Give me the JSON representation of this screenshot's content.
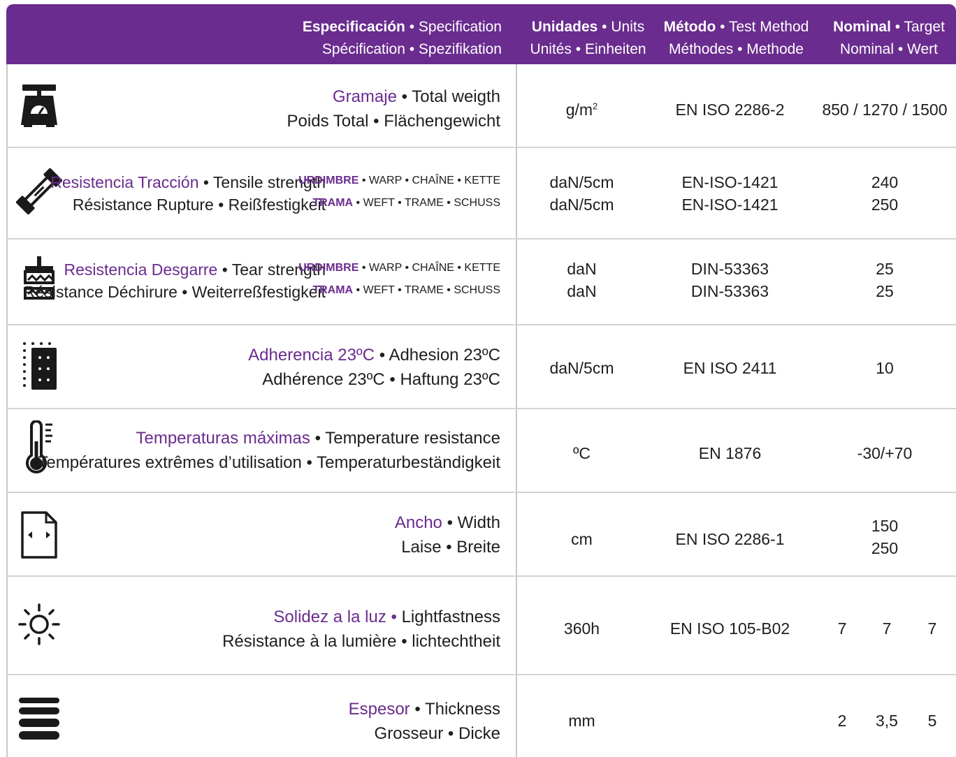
{
  "header": {
    "spec": {
      "bold": "Especificación",
      "rest1": "• Specification",
      "line2": "Spécification • Spezifikation"
    },
    "units": {
      "bold": "Unidades",
      "rest1": "• Units",
      "line2": "Unités • Einheiten"
    },
    "method": {
      "bold": "Método",
      "rest1": "• Test Method",
      "line2": "Méthodes • Methode"
    },
    "nominal": {
      "bold": "Nominal",
      "rest1": "• Target",
      "line2": "Nominal • Wert"
    }
  },
  "icons": {
    "weight": "scale-icon",
    "tensile": "tensile-test-icon",
    "tear": "tear-test-icon",
    "adhesion": "adhesion-icon",
    "temperature": "thermometer-icon",
    "width": "width-icon",
    "light": "sun-icon",
    "thickness": "thickness-icon"
  },
  "rows": {
    "weight": {
      "name": "Gramaje",
      "name_rest": "• Total weigth",
      "line2": "Poids Total • Flächengewicht",
      "units_base": "g/m",
      "units_sup": "2",
      "method": "EN ISO 2286-2",
      "nominal": "850 / 1270 / 1500"
    },
    "tensile": {
      "name": "Resistencia Tracción",
      "name_rest": "• Tensile strength",
      "line2": "Résistance Rupture • Reißfestigkeit",
      "dir1_accent": "URDIMBRE",
      "dir1_rest": "• WARP • CHAÎNE • KETTE",
      "dir2_accent": "TRAMA",
      "dir2_rest": "• WEFT • TRAME • SCHUSS",
      "units1": "daN/5cm",
      "units2": "daN/5cm",
      "method1": "EN-ISO-1421",
      "method2": "EN-ISO-1421",
      "nominal1": "240",
      "nominal2": "250"
    },
    "tear": {
      "name": "Resistencia Desgarre",
      "name_rest": "• Tear strength",
      "line2": "Résistance Déchirure  • Weiterreßfestigkeit",
      "dir1_accent": "URDIMBRE",
      "dir1_rest": "• WARP • CHAÎNE • KETTE",
      "dir2_accent": "TRAMA",
      "dir2_rest": "• WEFT • TRAME • SCHUSS",
      "units1": "daN",
      "units2": "daN",
      "method1": "DIN-53363",
      "method2": "DIN-53363",
      "nominal1": "25",
      "nominal2": "25"
    },
    "adhesion": {
      "name": "Adherencia 23ºC",
      "name_rest": "• Adhesion 23ºC",
      "line2": "Adhérence 23ºC • Haftung 23ºC",
      "units": "daN/5cm",
      "method": "EN ISO 2411",
      "nominal": "10"
    },
    "temperature": {
      "name": "Temperaturas máximas",
      "name_rest": "• Temperature resistance",
      "line2": "Températures extrêmes d’utilisation • Temperaturbeständigkeit",
      "units": "ºC",
      "method": "EN 1876",
      "nominal": "-30/+70"
    },
    "width": {
      "name": "Ancho",
      "name_rest": "• Width",
      "line2": "Laise • Breite",
      "units": "cm",
      "method": "EN ISO 2286-1",
      "nominal1": "150",
      "nominal2": "250"
    },
    "light": {
      "name": "Solidez a la luz •",
      "name_rest": "Lightfastness",
      "line2": "Résistance à la lumière • lichtechtheit",
      "units": "360h",
      "method": "EN ISO 105-B02",
      "nominal": [
        "7",
        "7",
        "7"
      ]
    },
    "thickness": {
      "name": "Espesor",
      "name_rest": "• Thickness",
      "line2": "Grosseur • Dicke",
      "units": "mm",
      "method": "",
      "nominal": [
        "2",
        "3,5",
        "5"
      ]
    }
  },
  "colors": {
    "accent": "#6a2c8e",
    "text": "#1e1e1e",
    "grid": "#d4d4d4"
  }
}
